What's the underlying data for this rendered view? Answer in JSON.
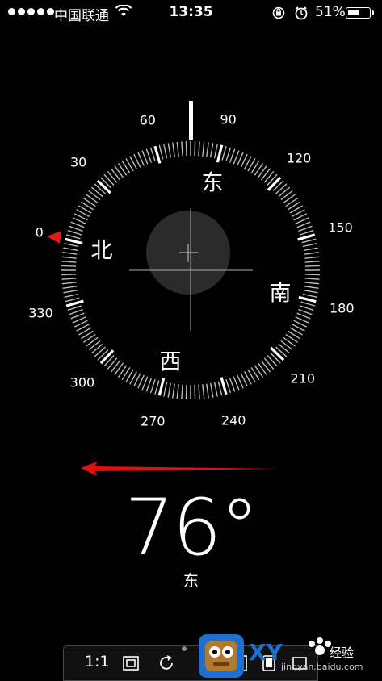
{
  "status": {
    "carrier": "中国联通",
    "time": "13:35",
    "battery": "51%"
  },
  "compass": {
    "degree_labels": [
      "0",
      "30",
      "60",
      "90",
      "120",
      "150",
      "180",
      "210",
      "240",
      "270",
      "300",
      "330"
    ],
    "directions": {
      "north": "北",
      "east": "东",
      "south": "南",
      "west": "西"
    }
  },
  "heading": {
    "value": "76°",
    "direction": "东"
  },
  "toolbar": {
    "zoom_label": "1:1"
  },
  "watermark": {
    "brand": "XY",
    "sub": "jingyan.baidu.com",
    "jy": "经验"
  }
}
